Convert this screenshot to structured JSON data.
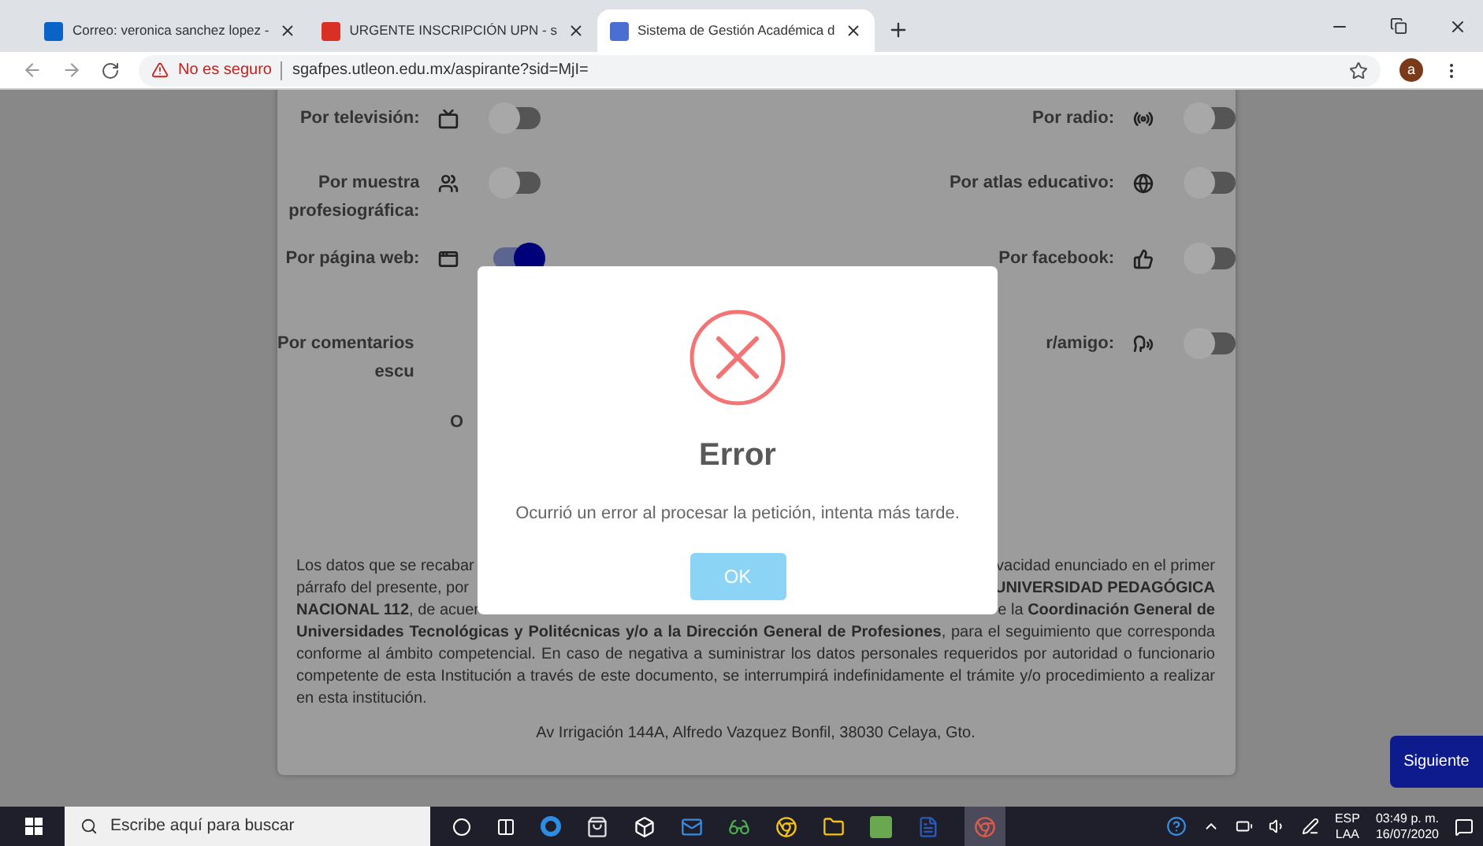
{
  "browser": {
    "tabs": [
      {
        "title": "Correo: veronica sanchez lopez -",
        "selected": false
      },
      {
        "title": "URGENTE INSCRIPCIÓN UPN - s",
        "selected": false
      },
      {
        "title": "Sistema de Gestión Académica d",
        "selected": true
      }
    ],
    "security": "No es seguro",
    "url": "sgafpes.utleon.edu.mx/aspirante?sid=MjI=",
    "avatar": "a"
  },
  "options": [
    {
      "left": {
        "label": [
          "Por televisión:"
        ],
        "on": false
      },
      "right": {
        "label": [
          "Por radio:"
        ],
        "on": false
      }
    },
    {
      "left": {
        "label": [
          "Por muestra",
          "profesiográfica:"
        ],
        "on": false
      },
      "right": {
        "label": [
          "Por atlas educativo:"
        ],
        "on": false
      }
    },
    {
      "left": {
        "label": [
          "Por página web:"
        ],
        "on": true
      },
      "right": {
        "label": [
          "Por facebook:"
        ],
        "on": false
      }
    },
    {
      "left": {
        "label": [
          "Por comentarios",
          "escu"
        ]
      },
      "right": {
        "label": [
          "r/amigo:"
        ],
        "on": false
      }
    },
    {
      "left": {
        "label": [
          "O"
        ]
      }
    }
  ],
  "privacy": {
    "line_1_left": "Los datos que se recabar",
    "line_1_right": "vacidad enunciado en el primer",
    "line_2_left": "párrafo del presente, por",
    "line_2_right": "**UNIVERSIDAD PEDAGÓGICA**",
    "line_3_left": "**NACIONAL 112**, de acuer",
    "line_3_right": "e la **Coordinación General de**",
    "rest": "**Universidades Tecnológicas y Politécnicas y/o a la Dirección General de Profesiones**, para el seguimiento que corresponda conforme al ámbito competencial. En caso de negativa a suministrar los datos personales requeridos por autoridad o funcionario competente de esta Institución a través de este documento, se interrumpirá indefinidamente el trámite y/o procedimiento a realizar en esta institución."
  },
  "address": "Av Irrigación 144A, Alfredo Vazquez Bonfil, 38030 Celaya, Gto.",
  "next_button": "Siguiente",
  "dialog": {
    "title": "Error",
    "message": "Ocurrió un error al procesar la petición, intenta más tarde.",
    "button": "OK"
  },
  "taskbar": {
    "search_placeholder": "Escribe aquí para buscar",
    "language": "ESP",
    "layout": "LAA",
    "time": "03:49 p. m.",
    "date": "16/07/2020"
  }
}
